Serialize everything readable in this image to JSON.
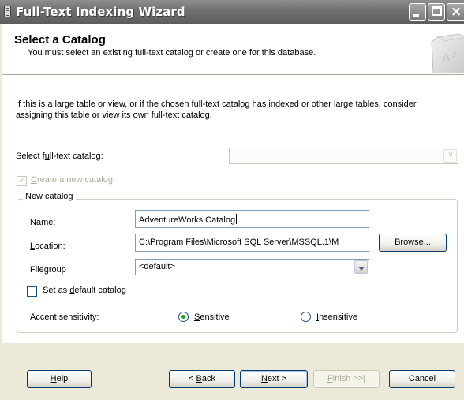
{
  "window": {
    "title": "Full-Text Indexing Wizard"
  },
  "header": {
    "title": "Select a Catalog",
    "subtitle": "You must select an existing full-text catalog or create one for this database.",
    "icon": "catalog-az-icon"
  },
  "info_text": "If this is a large table or view, or if the chosen full-text catalog has indexed or other large tables, consider assigning this table or view its own full-text catalog.",
  "select_catalog": {
    "label_pre": "Select f",
    "label_u": "u",
    "label_post": "ll-text catalog:",
    "value": ""
  },
  "create_new": {
    "label_u": "C",
    "label_post": "reate a new catalog",
    "checked": true
  },
  "new_catalog": {
    "legend": "New catalog",
    "name": {
      "label_pre": "Na",
      "label_u": "m",
      "label_post": "e:",
      "value": "AdventureWorks Catalog"
    },
    "location": {
      "label_u": "L",
      "label_post": "ocation:",
      "value": "C:\\Program Files\\Microsoft SQL Server\\MSSQL.1\\M",
      "browse_label": "Browse..."
    },
    "filegroup": {
      "label_pre": "File",
      "label_u": "g",
      "label_post": "roup",
      "value": "<default>"
    },
    "set_default": {
      "label_pre": "Set as ",
      "label_u": "d",
      "label_post": "efault catalog",
      "checked": false
    },
    "accent": {
      "label": "Accent sensitivity:",
      "sensitive": {
        "label_u": "S",
        "label_post": "ensitive",
        "selected": true
      },
      "insensitive": {
        "label_u": "I",
        "label_post": "nsensitive",
        "selected": false
      }
    }
  },
  "buttons": {
    "help": {
      "label_u": "H",
      "label_post": "elp"
    },
    "back": {
      "label_pre": "< ",
      "label_u": "B",
      "label_post": "ack"
    },
    "next": {
      "label_u": "N",
      "label_post": "ext >"
    },
    "finish": {
      "label_u": "F",
      "label_post": "inish >>|"
    },
    "cancel": {
      "label": "Cancel"
    }
  },
  "colors": {
    "titlebar": "#707070",
    "accent_radio": "#21a121",
    "disabled_text": "#aca899"
  }
}
